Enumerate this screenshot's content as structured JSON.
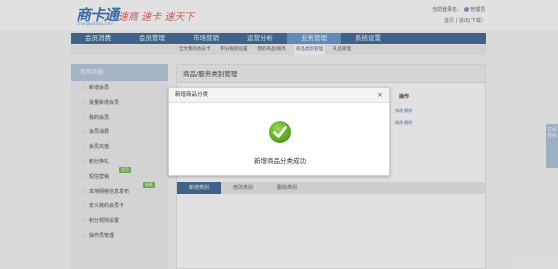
{
  "header": {
    "logo_cn": "商卡通",
    "logo_url": "shangkatong.com",
    "slogan": "速商 速卡 速天下",
    "user_prefix": "当前登录名：",
    "user_name": "管理员",
    "home_link": "首页",
    "logout_link": "退出(下载)"
  },
  "nav": {
    "items": [
      "会员消费",
      "会员管理",
      "市场营销",
      "运营分析",
      "业务管理",
      "系统设置"
    ],
    "active_index": 4
  },
  "subnav": {
    "items": [
      "全文我的会员卡",
      "积分规则设置",
      "我的商品/服务",
      "商品类别管理",
      "礼品管理"
    ],
    "active_index": 3
  },
  "sidebar": {
    "title": "常用功能",
    "items": [
      {
        "label": "新增会员",
        "tag": ""
      },
      {
        "label": "批量新增会员",
        "tag": ""
      },
      {
        "label": "我的会员",
        "tag": ""
      },
      {
        "label": "会员消费",
        "tag": ""
      },
      {
        "label": "会员充值",
        "tag": ""
      },
      {
        "label": "积分换礼",
        "tag": ""
      },
      {
        "label": "短信营销",
        "tag": "会员"
      },
      {
        "label": "本地网络信息发布",
        "tag": "新推"
      },
      {
        "label": "定义我的会员卡",
        "tag": ""
      },
      {
        "label": "积分规则设置",
        "tag": ""
      },
      {
        "label": "操作员管理",
        "tag": ""
      }
    ]
  },
  "panel": {
    "title": "商品/服务类别管理",
    "column_header": "操作",
    "row_actions": [
      "修改 删除",
      "修改 删除"
    ],
    "tabs": [
      "新增类别",
      "修改类别",
      "删除类别"
    ],
    "active_tab": 0
  },
  "modal": {
    "title": "新增商品分类",
    "close_label": "×",
    "message": "新增商品分类成功"
  },
  "float_tab": {
    "label": "在线客服"
  },
  "colors": {
    "nav_bg": "#2f5d8f",
    "nav_active": "#5b8fcd",
    "success_green": "#6cb33f",
    "brand_blue": "#2a6bb0"
  }
}
